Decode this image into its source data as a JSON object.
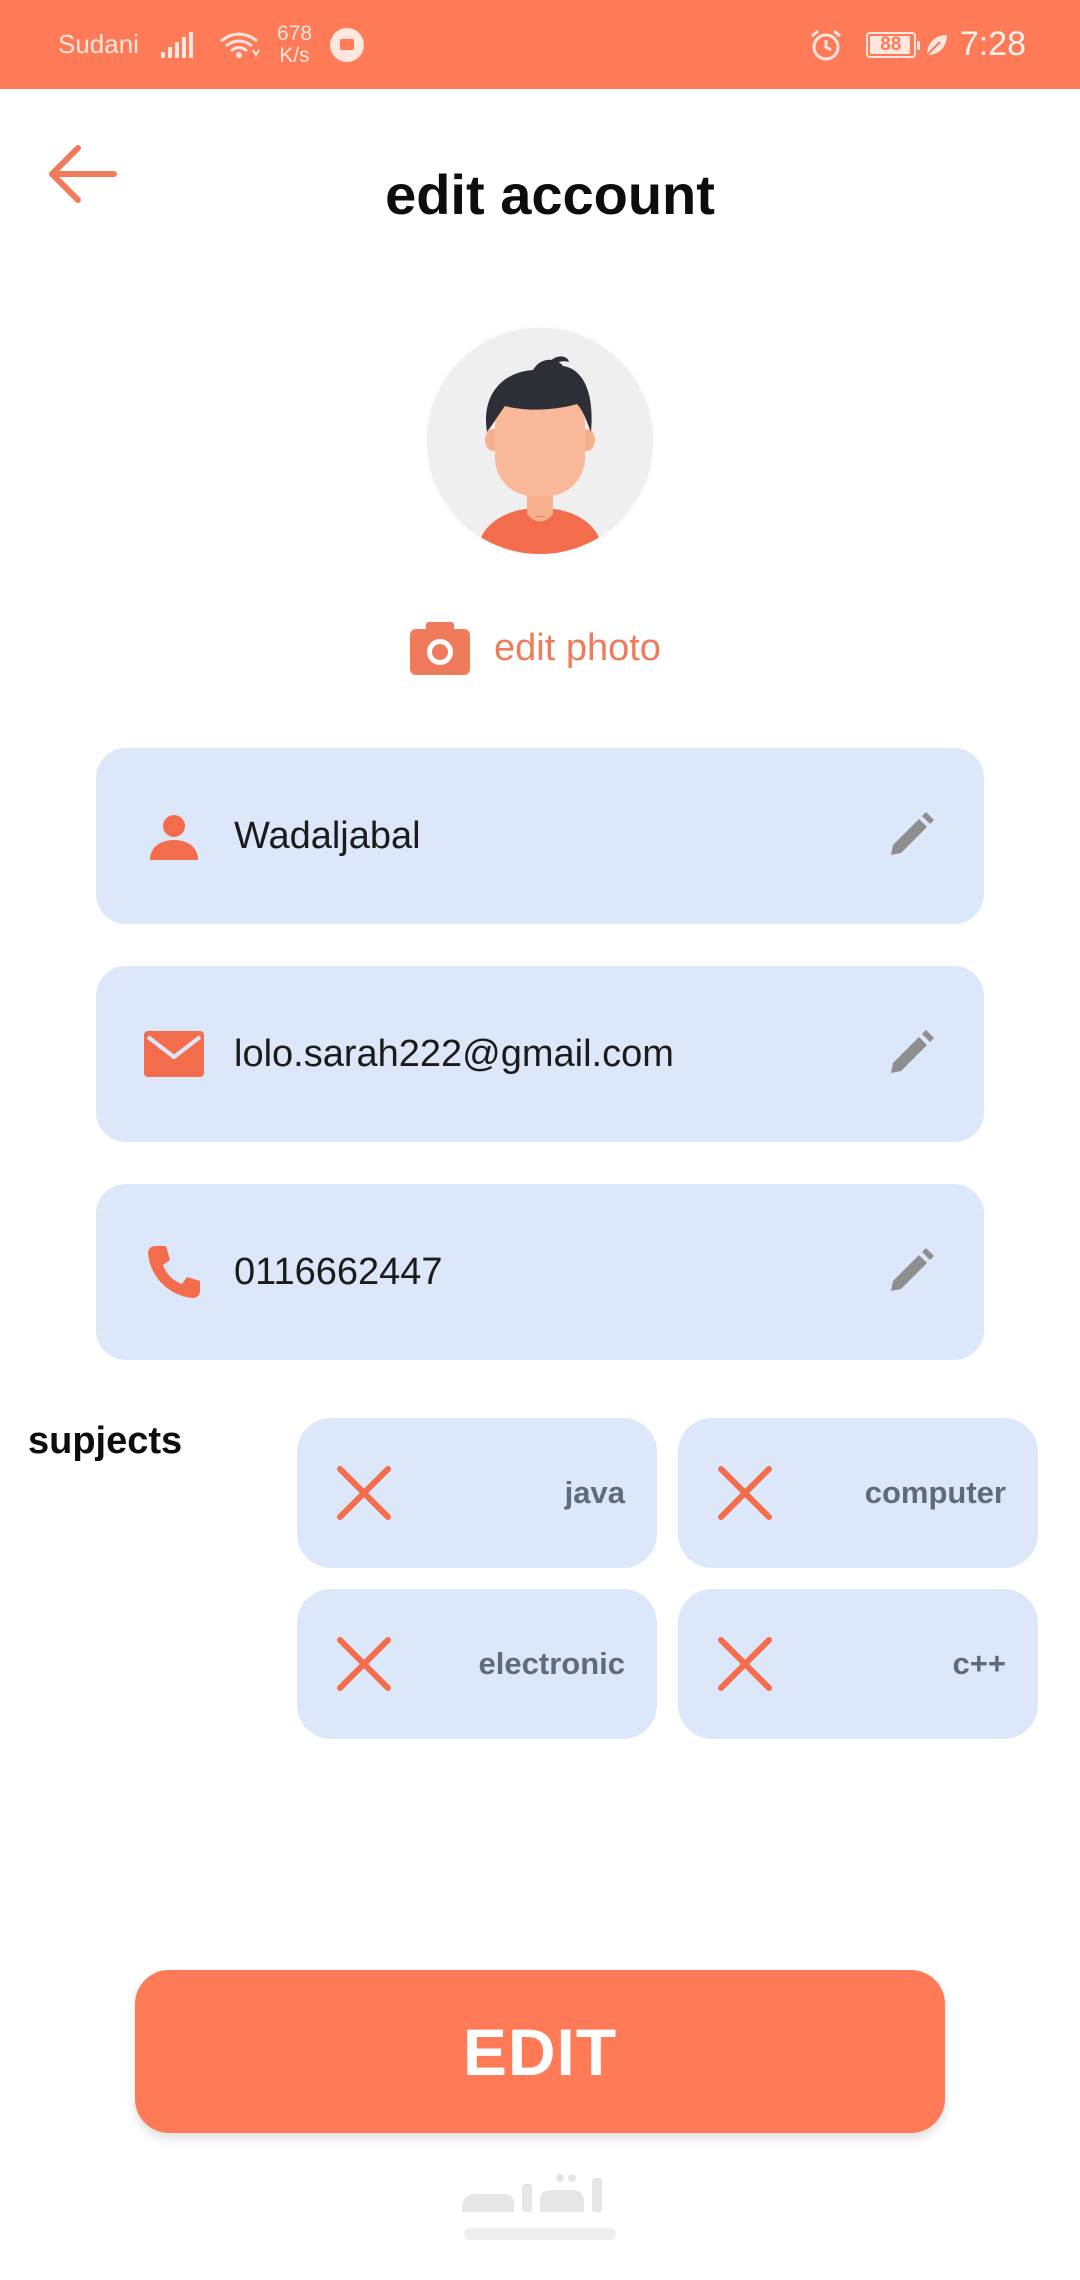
{
  "status_bar": {
    "carrier": "Sudani",
    "speed_value": "678",
    "speed_unit": "K/s",
    "battery": "88",
    "time": "7:28",
    "icons": [
      "signal-icon",
      "wifi-icon",
      "download-notification-icon",
      "alarm-icon",
      "battery-icon",
      "leaf-icon"
    ]
  },
  "header": {
    "title": "edit account",
    "back_icon": "back-arrow-icon"
  },
  "profile": {
    "edit_photo_label": "edit photo",
    "camera_icon": "camera-icon"
  },
  "fields": {
    "name": "Wadaljabal",
    "email": "lolo.sarah222@gmail.com",
    "phone": "0116662447"
  },
  "subjects": {
    "label": "supjects",
    "items": [
      "java",
      "computer",
      "electronic",
      "c++"
    ]
  },
  "actions": {
    "edit_label": "EDIT"
  },
  "watermark": {
    "arabic": "مستقل",
    "latin": "mostaql.com"
  },
  "colors": {
    "accent": "#ff7a57",
    "field_bg": "#dce8fa",
    "icon_gray": "#8e8e8e"
  }
}
